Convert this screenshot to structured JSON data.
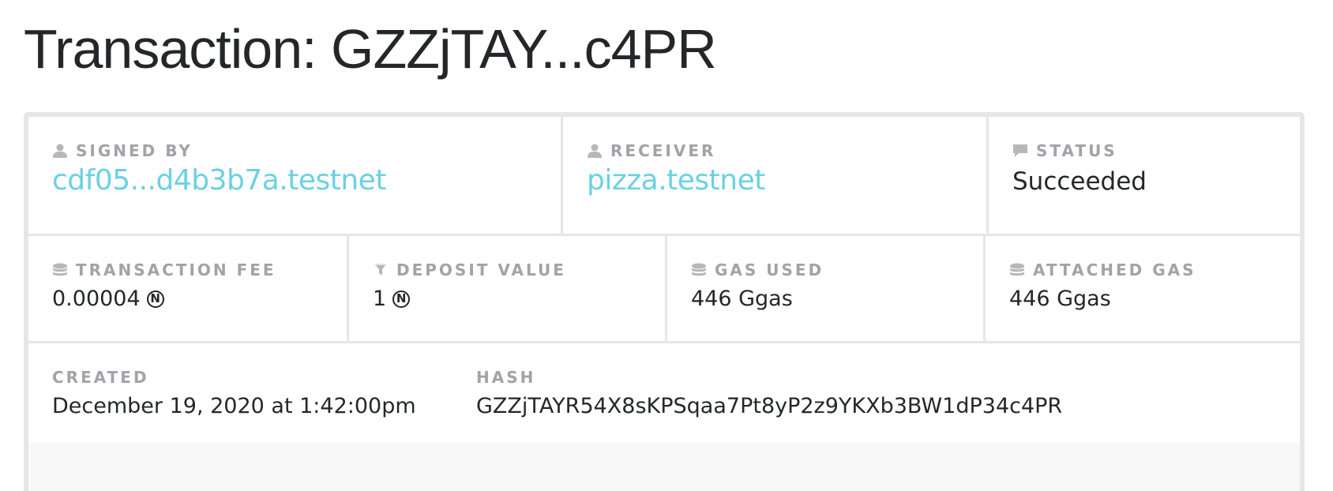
{
  "page": {
    "title": "Transaction: GZZjTAY...c4PR"
  },
  "signed_by": {
    "label": "SIGNED BY",
    "value": "cdf05...d4b3b7a.testnet",
    "icon": "user-icon"
  },
  "receiver": {
    "label": "RECEIVER",
    "value": "pizza.testnet",
    "icon": "user-icon"
  },
  "status": {
    "label": "STATUS",
    "value": "Succeeded",
    "icon": "comment-icon"
  },
  "transaction_fee": {
    "label": "TRANSACTION FEE",
    "value": "0.00004",
    "currency_symbol": "N",
    "icon": "coins-icon"
  },
  "deposit_value": {
    "label": "DEPOSIT VALUE",
    "value": "1",
    "currency_symbol": "N",
    "icon": "filter-icon"
  },
  "gas_used": {
    "label": "GAS USED",
    "value": "446 Ggas",
    "icon": "coins-icon"
  },
  "attached_gas": {
    "label": "ATTACHED GAS",
    "value": "446 Ggas",
    "icon": "coins-icon"
  },
  "created": {
    "label": "CREATED",
    "value": "December 19, 2020 at 1:42:00pm"
  },
  "hash": {
    "label": "HASH",
    "value": "GZZjTAYR54X8sKPSqaa7Pt8yP2z9YKXb3BW1dP34c4PR"
  },
  "colors": {
    "link": "#6ad1e3",
    "label": "#a2a2a8",
    "text": "#24272a",
    "border": "#e6e6e6"
  }
}
